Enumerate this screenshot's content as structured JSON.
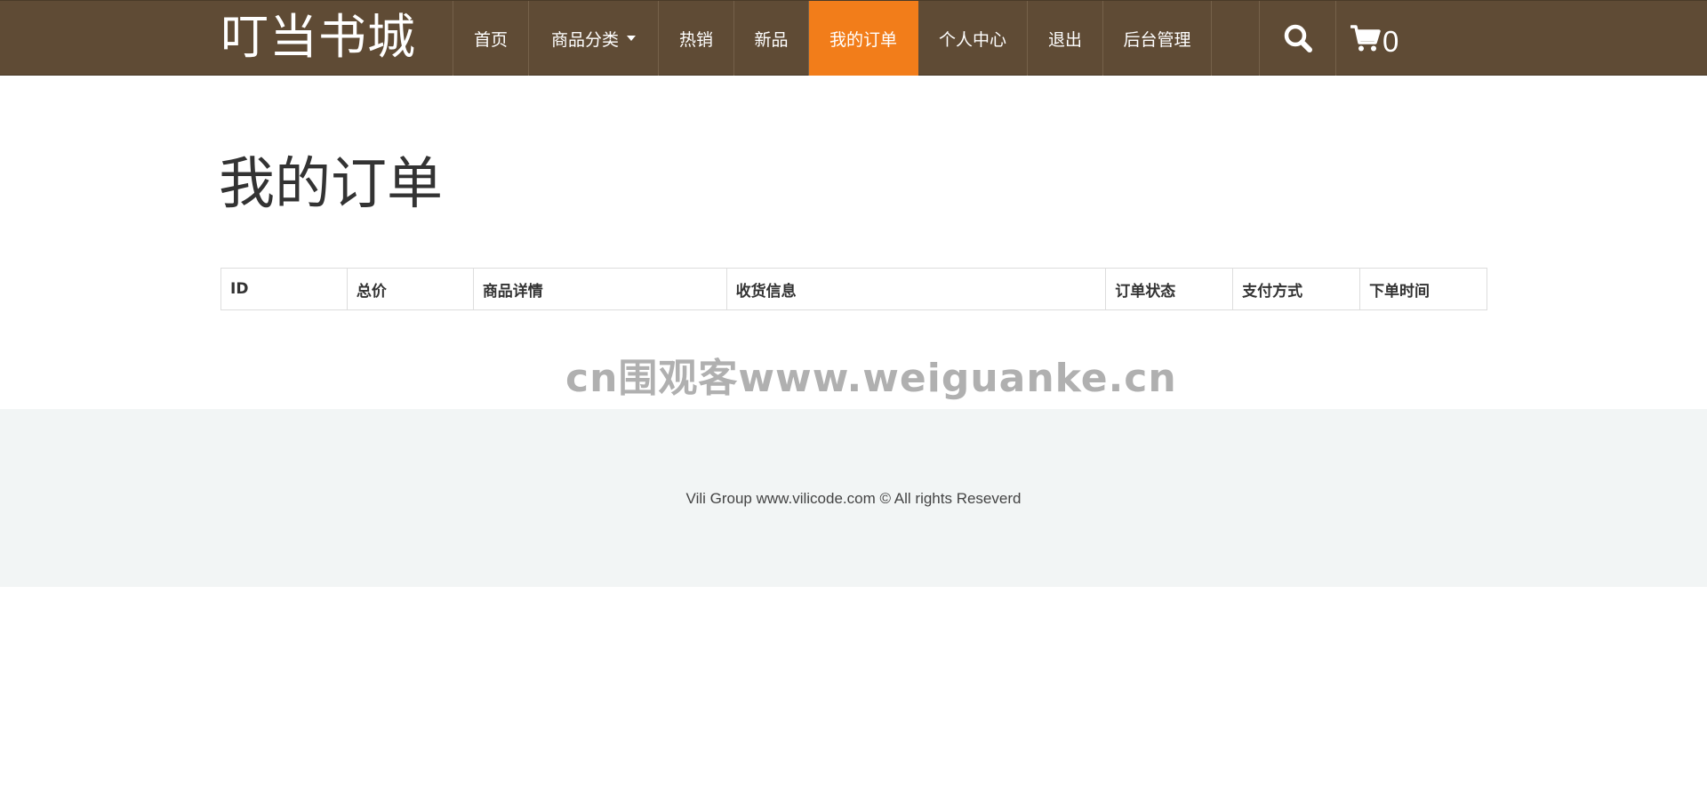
{
  "header": {
    "brand": "叮当书城",
    "nav": [
      {
        "label": "首页"
      },
      {
        "label": "商品分类"
      },
      {
        "label": "热销"
      },
      {
        "label": "新品"
      },
      {
        "label": "我的订单"
      },
      {
        "label": "个人中心"
      },
      {
        "label": "退出"
      },
      {
        "label": "后台管理"
      }
    ],
    "active_nav": "我的订单",
    "cart_count": "0",
    "icons": {
      "search": "search-icon",
      "cart": "cart-icon"
    },
    "colors": {
      "navbar": "#5f4b35",
      "active": "#f27d1a"
    }
  },
  "main": {
    "title": "我的订单",
    "table": {
      "columns": [
        "ID",
        "总价",
        "商品详情",
        "收货信息",
        "订单状态",
        "支付方式",
        "下单时间"
      ],
      "rows": []
    }
  },
  "watermark": "cn围观客www.weiguanke.cn",
  "footer": {
    "text": "Vili Group www.vilicode.com © All rights Reseverd"
  }
}
